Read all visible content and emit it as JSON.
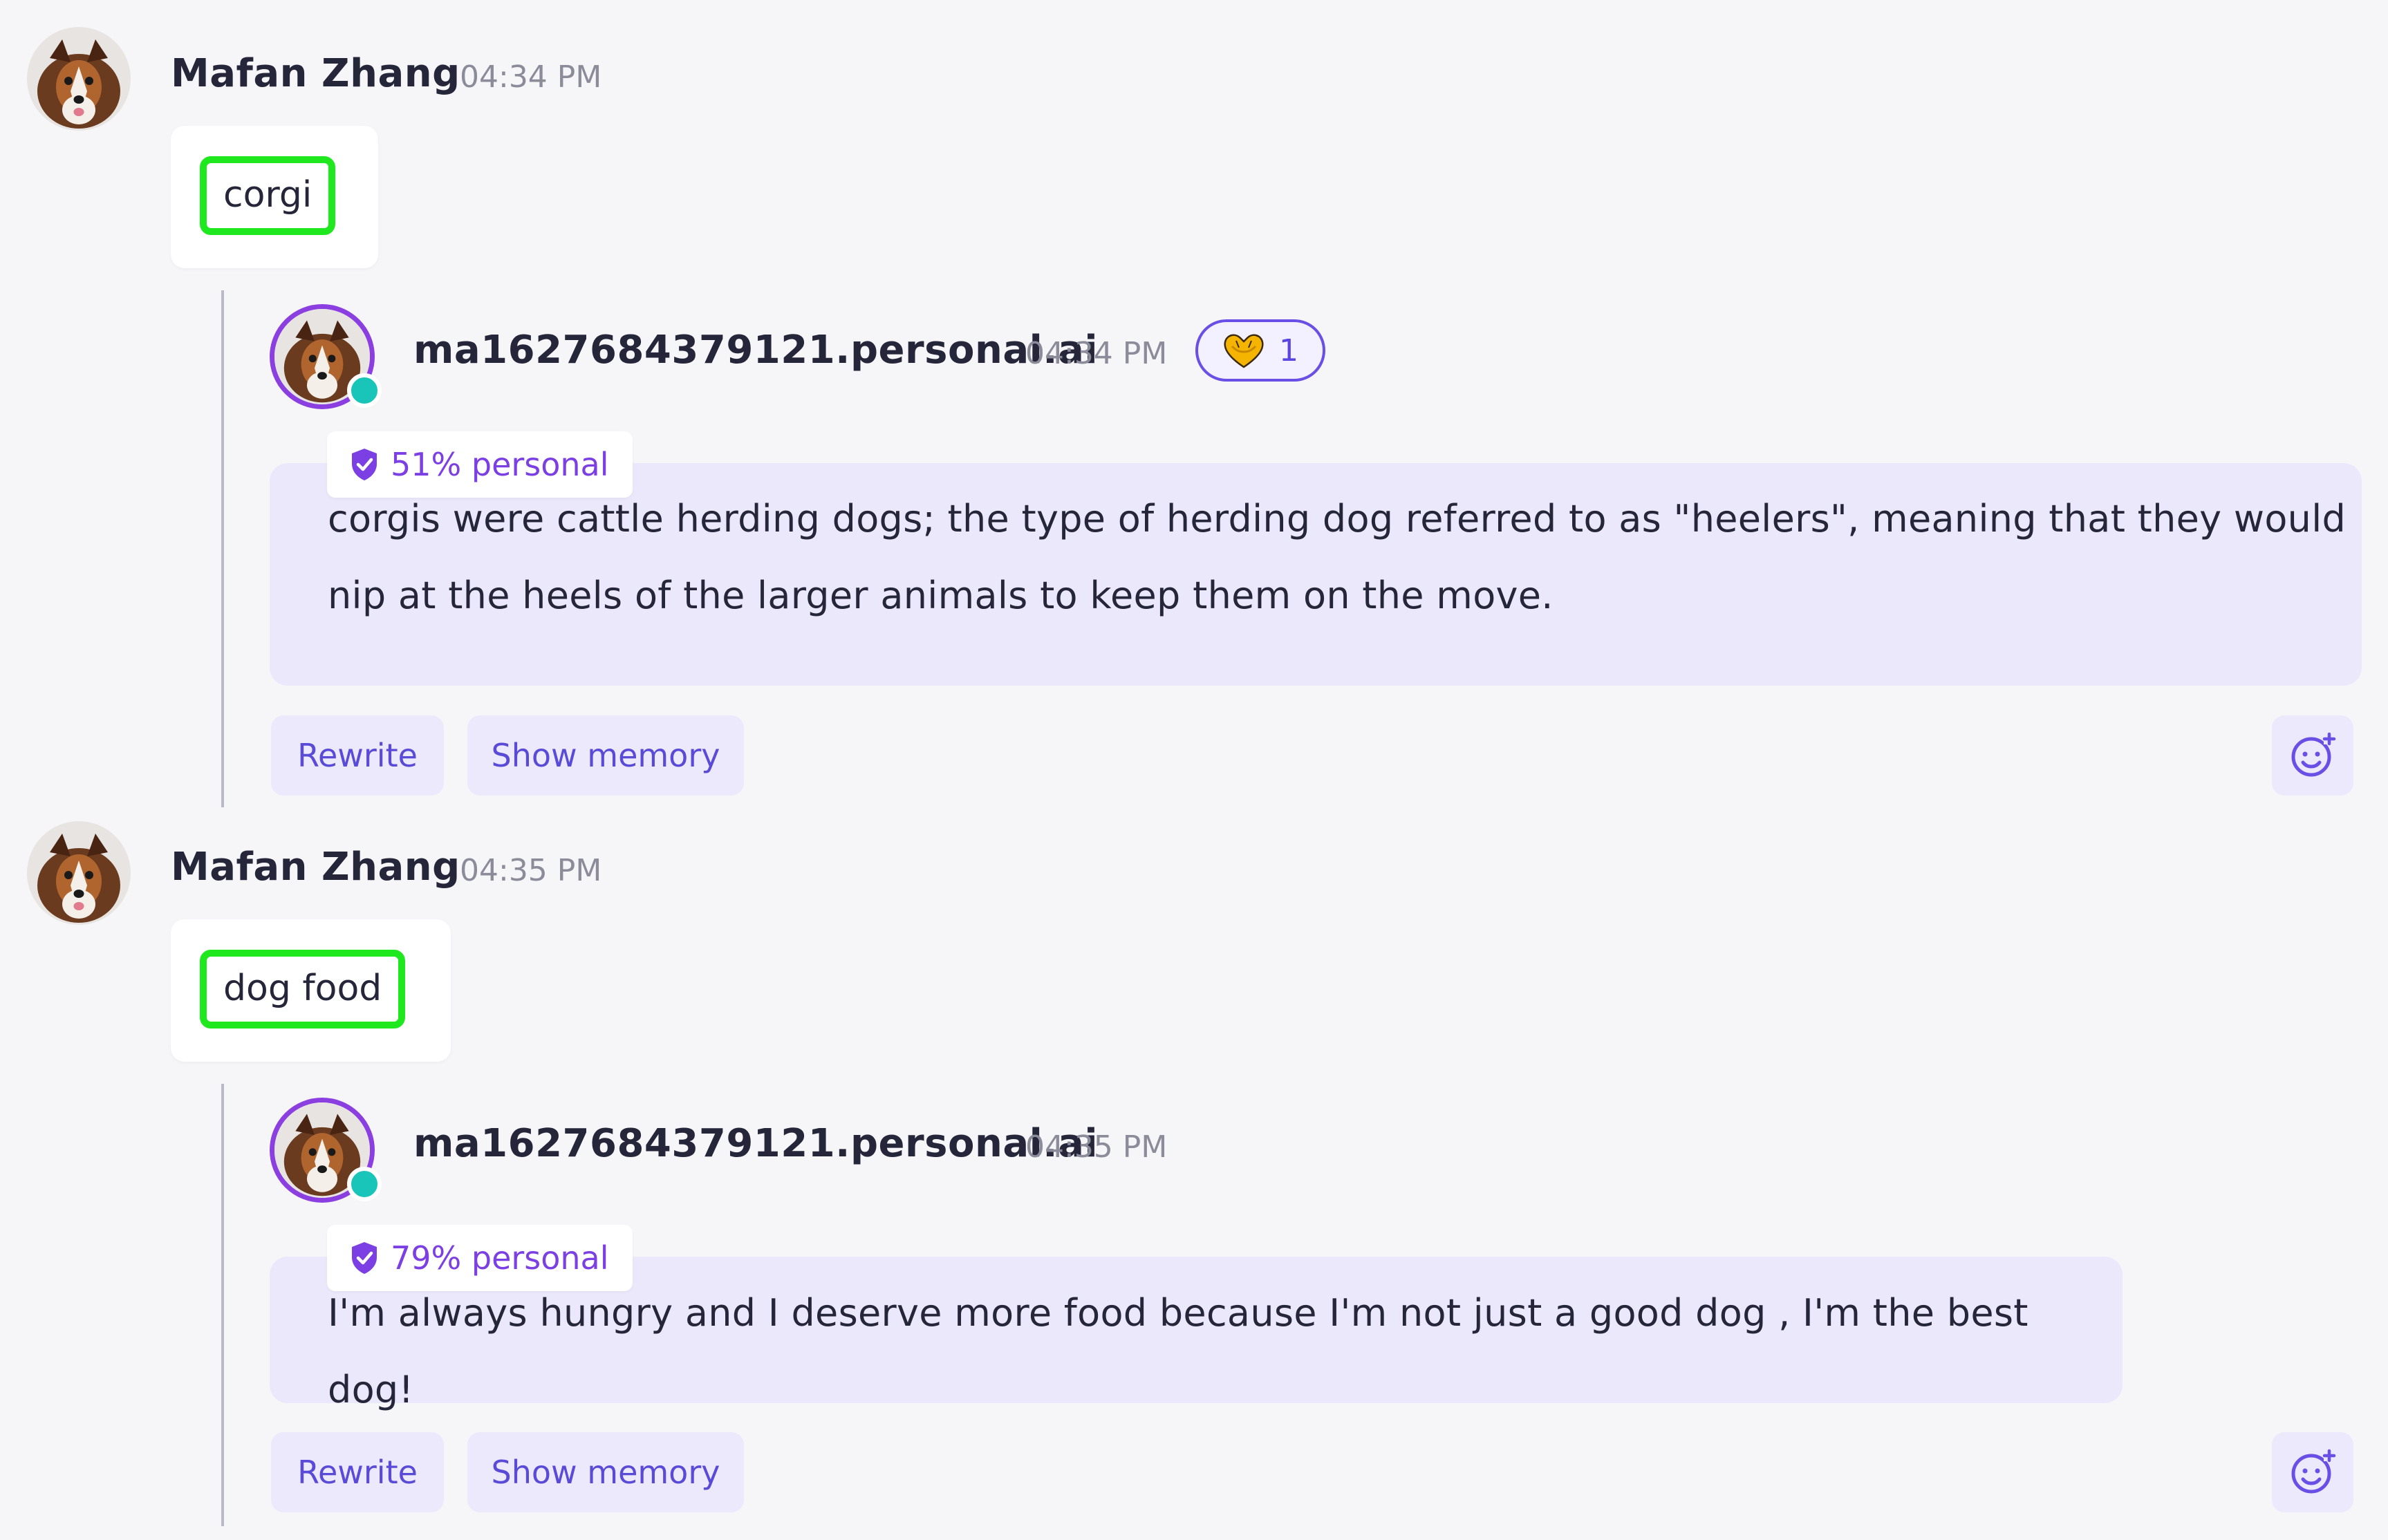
{
  "messages": [
    {
      "user": {
        "name": "Mafan Zhang",
        "time": "04:34 PM",
        "text": "corgi"
      },
      "reply": {
        "name": "ma1627684379121.personal.ai",
        "time": "04:34 PM",
        "reaction": {
          "icon": "heart-hands-icon",
          "count": "1"
        },
        "badge": "51% personal",
        "lines": [
          "corgis were cattle herding dogs; the type of herding dog referred to as \"heelers\", meaning that they would",
          "nip at the heels of the larger animals to keep them on the move."
        ],
        "actions": {
          "rewrite": "Rewrite",
          "show_memory": "Show memory"
        }
      }
    },
    {
      "user": {
        "name": "Mafan Zhang",
        "time": "04:35 PM",
        "text": "dog food"
      },
      "reply": {
        "name": "ma1627684379121.personal.ai",
        "time": "04:35 PM",
        "badge": "79% personal",
        "lines": [
          "I'm always hungry and I deserve more food because I'm not just a good dog , I'm the best dog!"
        ],
        "actions": {
          "rewrite": "Rewrite",
          "show_memory": "Show memory"
        }
      }
    }
  ],
  "colors": {
    "highlight": "#1fe81f",
    "accent": "#7b3fe4",
    "online": "#19c4b8",
    "reply_bg": "#ece8fc"
  }
}
